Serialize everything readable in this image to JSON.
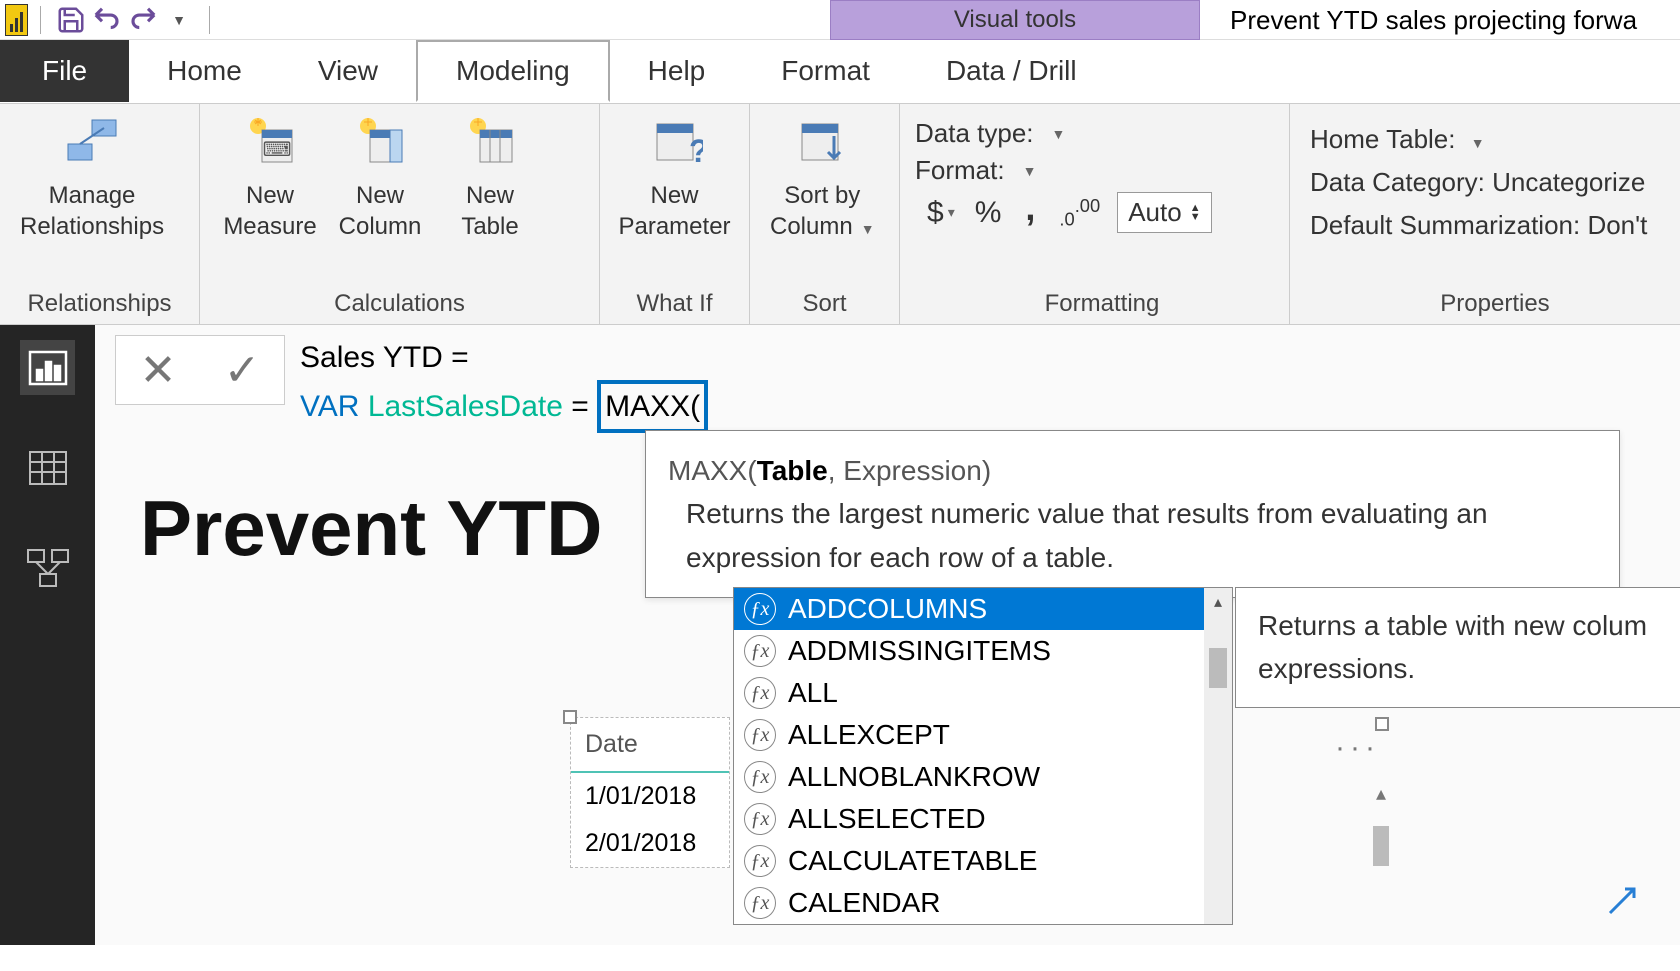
{
  "qat": {
    "logo": "logo"
  },
  "context_tab": "Visual tools",
  "doc_title": "Prevent YTD sales projecting forwa",
  "tabs": {
    "file": "File",
    "home": "Home",
    "view": "View",
    "modeling": "Modeling",
    "help": "Help",
    "format": "Format",
    "datadrill": "Data / Drill"
  },
  "ribbon": {
    "relationships": {
      "manage": "Manage\nRelationships",
      "group": "Relationships"
    },
    "calculations": {
      "measure": "New\nMeasure",
      "column": "New\nColumn",
      "table": "New\nTable",
      "group": "Calculations"
    },
    "whatif": {
      "param": "New\nParameter",
      "group": "What If"
    },
    "sort": {
      "sortby": "Sort by\nColumn",
      "group": "Sort"
    },
    "formatting": {
      "datatype": "Data type:",
      "format": "Format:",
      "auto": "Auto",
      "group": "Formatting"
    },
    "properties": {
      "home": "Home Table:",
      "category": "Data Category: Uncategorize",
      "summ": "Default Summarization: Don't",
      "group": "Properties"
    }
  },
  "formula": {
    "line1_name": "Sales YTD",
    "line1_eq": " = ",
    "line2_var": "VAR",
    "line2_name": "LastSalesDate",
    "line2_eq": " = ",
    "line2_func": "MAXX("
  },
  "tooltip": {
    "sig_fn": "MAXX(",
    "sig_p1": "Table",
    "sig_rest": ", Expression)",
    "desc": "Returns the largest numeric value that results from evaluating an expression for each row of a table."
  },
  "intellisense": [
    "ADDCOLUMNS",
    "ADDMISSINGITEMS",
    "ALL",
    "ALLEXCEPT",
    "ALLNOBLANKROW",
    "ALLSELECTED",
    "CALCULATETABLE",
    "CALENDAR"
  ],
  "side_tip": "Returns a table with new colum expressions.",
  "report_title": "Prevent YTD",
  "table": {
    "header": "Date",
    "rows": [
      "1/01/2018",
      "2/01/2018"
    ]
  }
}
